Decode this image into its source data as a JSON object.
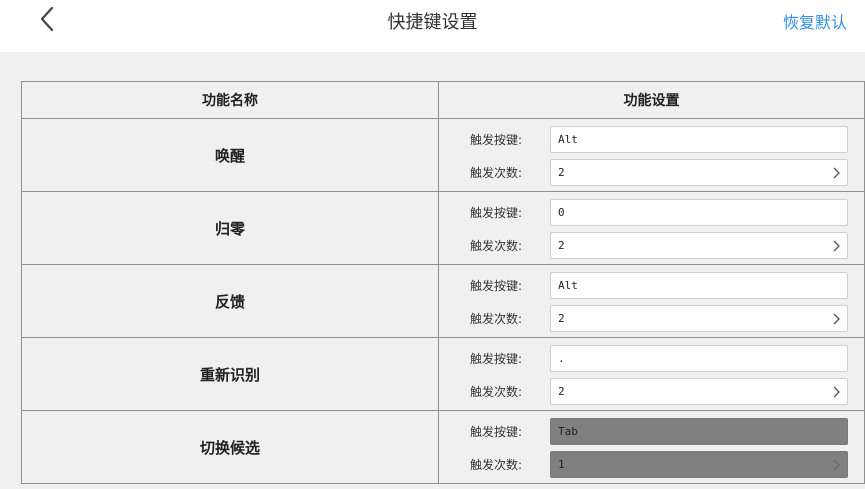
{
  "header": {
    "title": "快捷键设置",
    "reset_label": "恢复默认",
    "back_icon": "chevron-left-icon"
  },
  "table": {
    "col_name": "功能名称",
    "col_settings": "功能设置",
    "key_label": "触发按键:",
    "count_label": "触发次数:",
    "rows": [
      {
        "name": "唤醒",
        "key": "Alt",
        "count": "2",
        "disabled": false
      },
      {
        "name": "归零",
        "key": "0",
        "count": "2",
        "disabled": false
      },
      {
        "name": "反馈",
        "key": "Alt",
        "count": "2",
        "disabled": false
      },
      {
        "name": "重新识别",
        "key": ".",
        "count": "2",
        "disabled": false
      },
      {
        "name": "切换候选",
        "key": "Tab",
        "count": "1",
        "disabled": true
      }
    ]
  },
  "colors": {
    "accent": "#2f8fe8",
    "disabled_field": "#808080"
  }
}
